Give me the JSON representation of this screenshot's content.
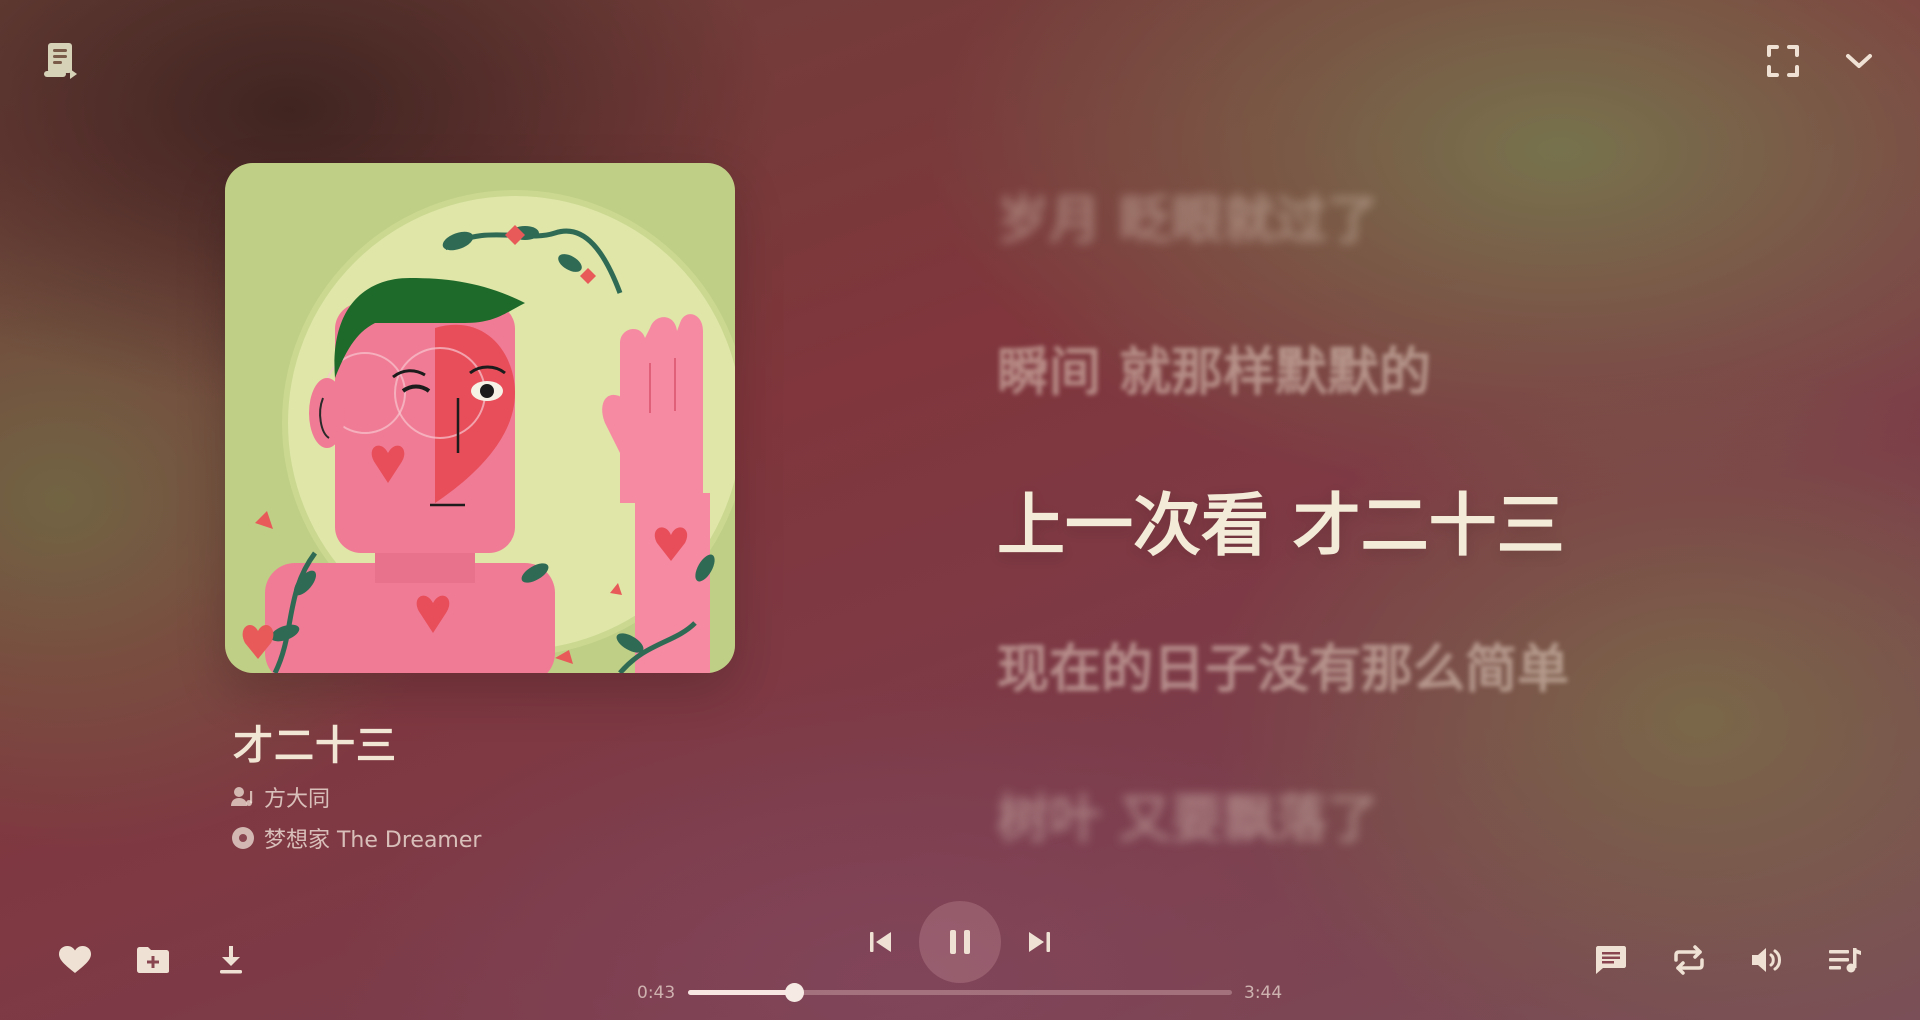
{
  "window": {
    "top_left_icon": "lyric-file-icon",
    "top_right_icons": [
      "fullscreen-icon",
      "chevron-down-icon"
    ]
  },
  "song": {
    "title": "才二十三",
    "artist": "方大同",
    "album": "梦想家 The Dreamer"
  },
  "lyrics": {
    "lines": [
      "岁月 眨眼就过了",
      "瞬间 就那样默默的",
      "上一次看 才二十三",
      "现在的日子没有那么简单",
      "树叶 又要飘落了"
    ],
    "active_index": 2
  },
  "player": {
    "current_time": "0:43",
    "total_time": "3:44",
    "progress_fraction": 0.195,
    "is_playing": true,
    "left_actions": [
      "heart-icon",
      "add-to-playlist-icon",
      "download-icon"
    ],
    "center_actions": [
      "previous-icon",
      "pause-icon",
      "next-icon"
    ],
    "right_actions": [
      "comment-icon",
      "repeat-icon",
      "volume-icon",
      "playlist-icon"
    ]
  },
  "colors": {
    "text_primary": "#f1e5d4",
    "icon": "#efe2d4",
    "accent_bg": "#7e3a42"
  }
}
